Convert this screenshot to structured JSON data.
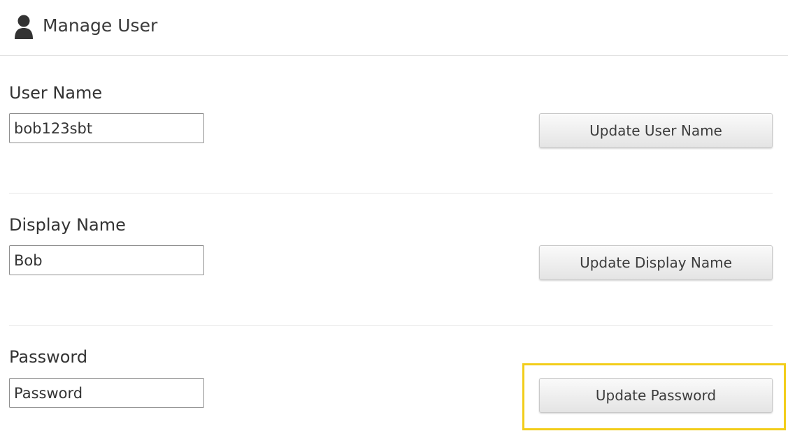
{
  "header": {
    "title": "Manage User",
    "icon": "user-icon"
  },
  "user_name": {
    "label": "User Name",
    "value": "bob123sbt",
    "button_label": "Update User Name"
  },
  "display_name": {
    "label": "Display Name",
    "value": "Bob",
    "button_label": "Update Display Name"
  },
  "password": {
    "label": "Password",
    "placeholder": "Password",
    "button_label": "Update Password"
  },
  "colors": {
    "highlight": "#f2cd1a",
    "icon": "#333333",
    "button_border": "#c9c9c9"
  }
}
